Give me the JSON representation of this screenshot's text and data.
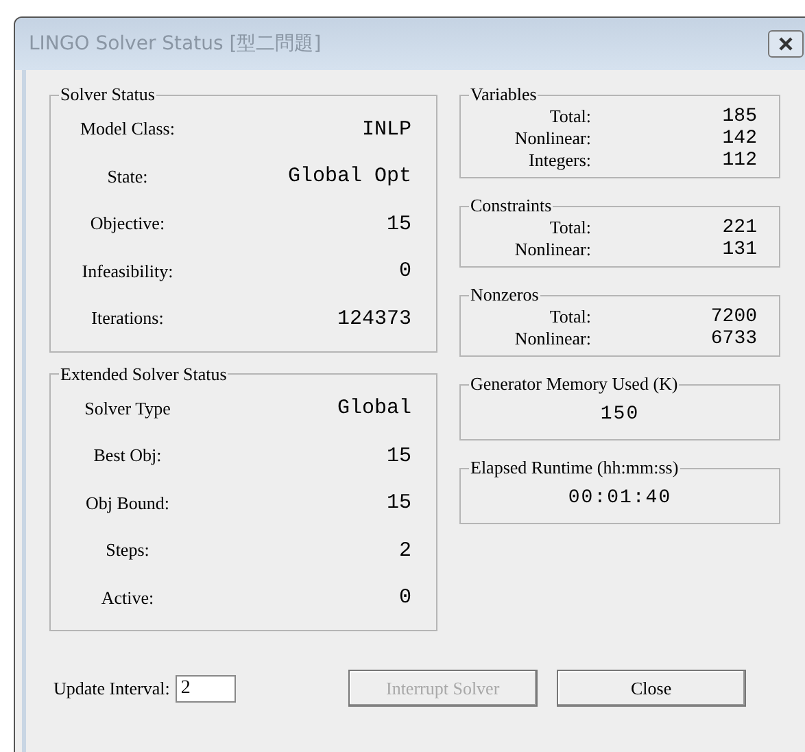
{
  "window": {
    "title": "LINGO Solver Status [型二問題]"
  },
  "left_groups": [
    {
      "title": "Solver Status",
      "rows": [
        {
          "label": "Model Class:",
          "value": "INLP"
        },
        {
          "label": "State:",
          "value": "Global Opt"
        },
        {
          "label": "Objective:",
          "value": "15"
        },
        {
          "label": "Infeasibility:",
          "value": "0"
        },
        {
          "label": "Iterations:",
          "value": "124373"
        }
      ]
    },
    {
      "title": "Extended Solver Status",
      "rows": [
        {
          "label": "Solver Type",
          "value": "Global"
        },
        {
          "label": "Best Obj:",
          "value": "15"
        },
        {
          "label": "Obj Bound:",
          "value": "15"
        },
        {
          "label": "Steps:",
          "value": "2"
        },
        {
          "label": "Active:",
          "value": "0"
        }
      ]
    }
  ],
  "right_groups": [
    {
      "kind": "table",
      "title": "Variables",
      "rows": [
        {
          "label": "Total:",
          "value": "185"
        },
        {
          "label": "Nonlinear:",
          "value": "142"
        },
        {
          "label": "Integers:",
          "value": "112"
        }
      ]
    },
    {
      "kind": "table",
      "title": "Constraints",
      "rows": [
        {
          "label": "Total:",
          "value": "221"
        },
        {
          "label": "Nonlinear:",
          "value": "131"
        }
      ]
    },
    {
      "kind": "table",
      "title": "Nonzeros",
      "rows": [
        {
          "label": "Total:",
          "value": "7200"
        },
        {
          "label": "Nonlinear:",
          "value": "6733"
        }
      ]
    },
    {
      "kind": "single",
      "title": "Generator Memory Used (K)",
      "value": "150"
    },
    {
      "kind": "single",
      "title": "Elapsed Runtime (hh:mm:ss)",
      "value": "00:01:40"
    }
  ],
  "update_interval": {
    "label": "Update Interval:",
    "value": "2"
  },
  "buttons": [
    {
      "label": "Interrupt Solver",
      "disabled": true
    },
    {
      "label": "Close",
      "disabled": false
    }
  ]
}
